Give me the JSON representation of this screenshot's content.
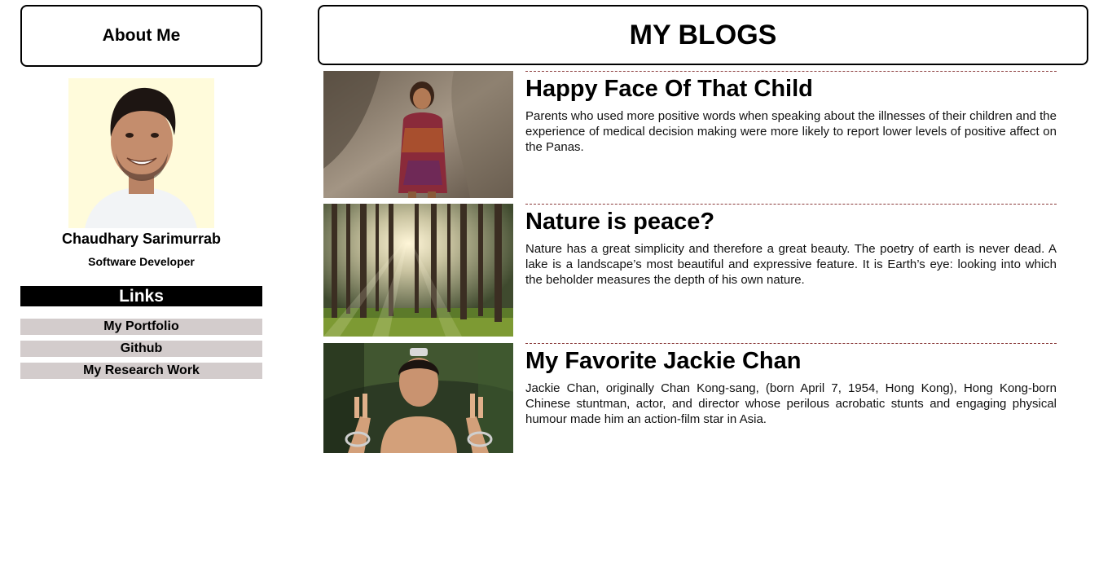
{
  "sidebar": {
    "about_title": "About Me",
    "profile": {
      "name": "Chaudhary Sarimurrab",
      "role": "Software Developer"
    },
    "links_title": "Links",
    "links": [
      {
        "label": "My Portfolio"
      },
      {
        "label": "Github"
      },
      {
        "label": "My Research Work"
      }
    ]
  },
  "main": {
    "title": "MY BLOGS",
    "posts": [
      {
        "title": "Happy Face Of That Child",
        "text": "Parents who used more positive words when speaking about the illnesses of their children and the experience of medical decision making were more likely to report lower levels of positive affect on the Panas."
      },
      {
        "title": "Nature is peace?",
        "text": "Nature has a great simplicity and therefore a great beauty. The poetry of earth is never dead. A lake is a landscape’s most beautiful and expressive feature. It is Earth’s eye: looking into which the beholder measures the depth of his own nature."
      },
      {
        "title": "My Favorite Jackie Chan",
        "text": "Jackie Chan, originally Chan Kong-sang, (born April 7, 1954, Hong Kong), Hong Kong-born Chinese stuntman, actor, and director whose perilous acrobatic stunts and engaging physical humour made him an action-film star in Asia."
      }
    ]
  }
}
